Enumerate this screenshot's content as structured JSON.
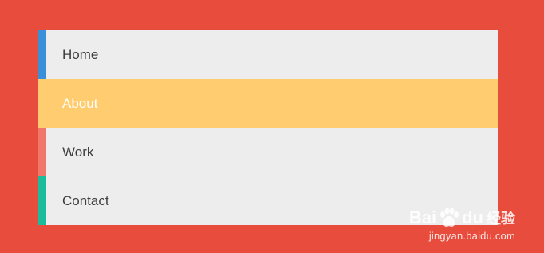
{
  "menu": {
    "items": [
      {
        "label": "Home",
        "accent": "#3a8fd9",
        "active": false
      },
      {
        "label": "About",
        "accent": "#ffcc6f",
        "active": true
      },
      {
        "label": "Work",
        "accent": "#f2776b",
        "active": false
      },
      {
        "label": "Contact",
        "accent": "#1abc9c",
        "active": false
      }
    ]
  },
  "watermark": {
    "brand_left": "Bai",
    "brand_right": "du",
    "brand_sub": "经验",
    "url": "jingyan.baidu.com"
  },
  "colors": {
    "background": "#e84c3d",
    "item_background": "#ededed",
    "active_background": "#ffcc6f",
    "text": "#3d3d3d",
    "active_text": "#ffffff"
  }
}
